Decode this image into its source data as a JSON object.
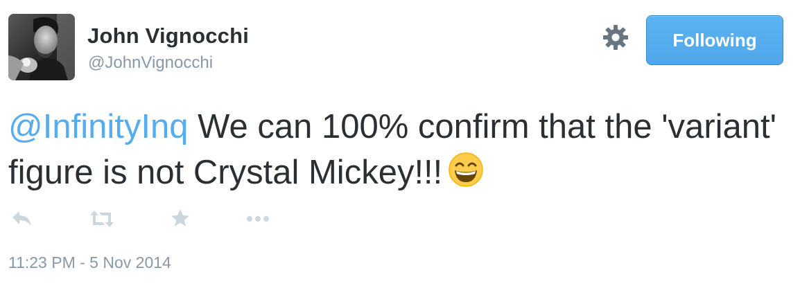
{
  "user": {
    "display_name": "John Vignocchi",
    "handle": "@JohnVignocchi"
  },
  "header": {
    "settings_icon": "gear-icon",
    "follow_button_label": "Following"
  },
  "tweet": {
    "mention": "@InfinityInq",
    "text": " We can 100% confirm that the 'variant' figure is not Crystal Mickey!!!",
    "emoji": "grinning-face-with-smiling-eyes"
  },
  "actions": {
    "reply_icon": "reply-icon",
    "retweet_icon": "retweet-icon",
    "favorite_icon": "star-icon",
    "more_icon": "more-icon"
  },
  "timestamp": "11:23 PM - 5 Nov 2014",
  "colors": {
    "link": "#55acee",
    "text": "#292f33",
    "muted": "#8899a6",
    "action_icon": "#ccd6dd",
    "button": "#55acee"
  }
}
